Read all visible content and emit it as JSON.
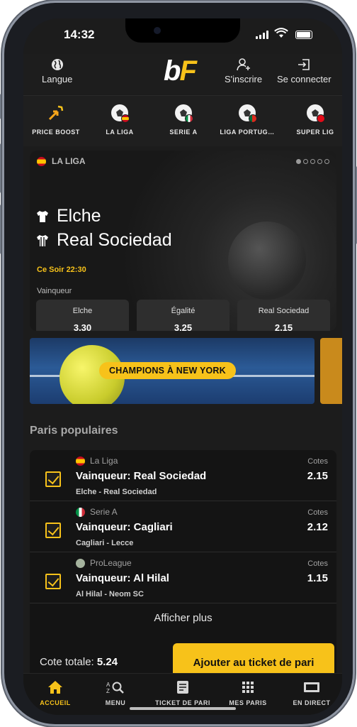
{
  "status": {
    "time": "14:32"
  },
  "header": {
    "language_label": "Langue",
    "logo_b": "b",
    "logo_f": "F",
    "signup_label": "S'inscrire",
    "login_label": "Se connecter"
  },
  "categories": [
    {
      "label": "PRICE BOOST",
      "icon": "price-boost-icon"
    },
    {
      "label": "LA LIGA",
      "icon": "football-spain-icon"
    },
    {
      "label": "SERIE A",
      "icon": "football-italy-icon"
    },
    {
      "label": "LIGA PORTUG…",
      "icon": "football-portugal-icon"
    },
    {
      "label": "SUPER LIG",
      "icon": "football-turkey-icon"
    }
  ],
  "hero": {
    "league": "LA LIGA",
    "home_team": "Elche",
    "away_team": "Real Sociedad",
    "kickoff": "Ce Soir 22:30",
    "market": "Vainqueur",
    "odds": [
      {
        "label": "Elche",
        "value": "3.30"
      },
      {
        "label": "Égalité",
        "value": "3.25"
      },
      {
        "label": "Real Sociedad",
        "value": "2.15"
      }
    ]
  },
  "banner": {
    "text": "CHAMPIONS À NEW YORK"
  },
  "popular": {
    "title": "Paris populaires",
    "items": [
      {
        "league": "La Liga",
        "selection": "Vainqueur: Real Sociedad",
        "match": "Elche - Real Sociedad",
        "odds_label": "Cotes",
        "odds": "2.15"
      },
      {
        "league": "Serie A",
        "selection": "Vainqueur: Cagliari",
        "match": "Cagliari - Lecce",
        "odds_label": "Cotes",
        "odds": "2.12"
      },
      {
        "league": "ProLeague",
        "selection": "Vainqueur: Al Hilal",
        "match": "Al Hilal - Neom SC",
        "odds_label": "Cotes",
        "odds": "1.15"
      }
    ],
    "show_more": "Afficher plus",
    "total_label": "Cote totale:",
    "total_value": "5.24",
    "add_button": "Ajouter au ticket de pari"
  },
  "tabs": [
    {
      "label": "ACCUEIL",
      "icon": "home-icon",
      "active": true
    },
    {
      "label": "MENU",
      "icon": "menu-search-icon"
    },
    {
      "label": "TICKET DE PARI",
      "icon": "bet-slip-icon"
    },
    {
      "label": "MES PARIS",
      "icon": "grid-icon"
    },
    {
      "label": "EN DIRECT",
      "icon": "live-icon"
    }
  ],
  "colors": {
    "accent": "#f7c21a",
    "background": "#1c1c1c",
    "card": "#141414"
  }
}
